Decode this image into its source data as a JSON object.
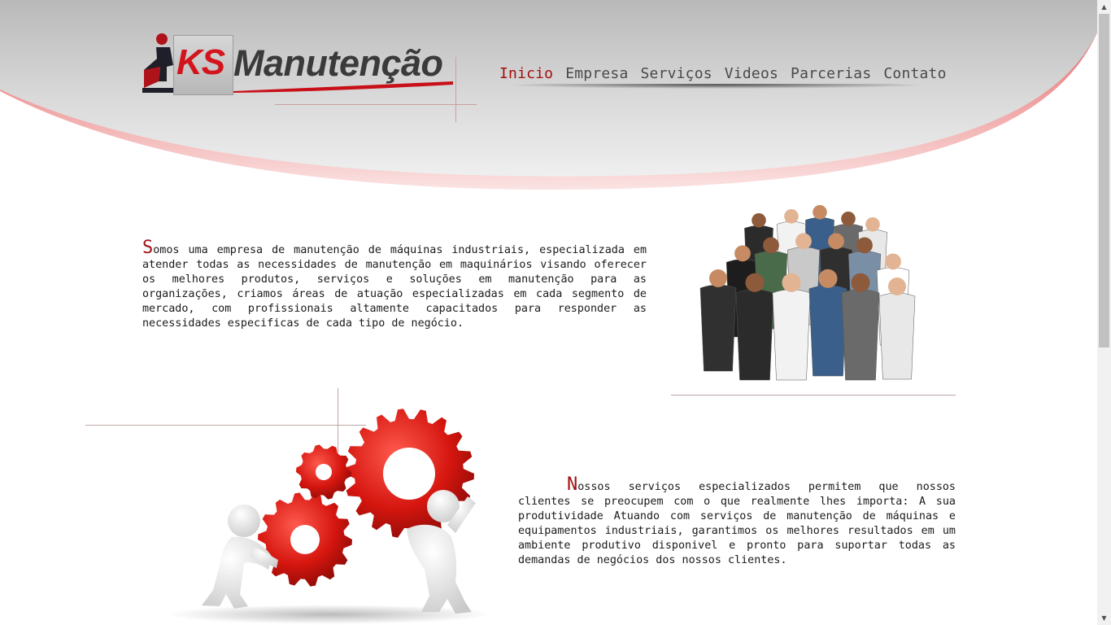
{
  "brand": {
    "ks": "KS",
    "name": "Manutenção",
    "color_primary": "#d3141c",
    "color_dark": "#3a3a3a"
  },
  "nav": {
    "items": [
      {
        "label": "Inicio",
        "active": true
      },
      {
        "label": "Empresa",
        "active": false
      },
      {
        "label": "Serviços",
        "active": false
      },
      {
        "label": "Videos",
        "active": false
      },
      {
        "label": "Parcerias",
        "active": false
      },
      {
        "label": "Contato",
        "active": false
      }
    ],
    "active_color": "#a10f0f"
  },
  "about": {
    "initial": "S",
    "text": "omos uma empresa de manutenção de máquinas industriais, especializada em atender todas as necessidades de manutenção em maquinários visando oferecer os melhores produtos, serviços e soluções em manutenção para as organizações, criamos áreas de atuação especializadas em cada segmento de mercado, com profissionais altamente capacitados para responder as necessidades especificas de cada tipo de negócio."
  },
  "services": {
    "initial": "N",
    "text": "ossos serviços especializados permitem que nossos clientes se preocupem com o que realmente lhes importa: A sua produtividade Atuando com serviços de manutenção de máquinas e equipamentos industriais, garantimos os melhores resultados em um ambiente produtivo disponivel e pronto para suportar todas as demandas de negócios dos nossos clientes."
  },
  "icons": {
    "people": "group-of-professionals-image",
    "gears": "figures-pushing-gears-image",
    "scroll_up": "scroll-up-arrow-icon",
    "scroll_down": "scroll-down-arrow-icon"
  }
}
